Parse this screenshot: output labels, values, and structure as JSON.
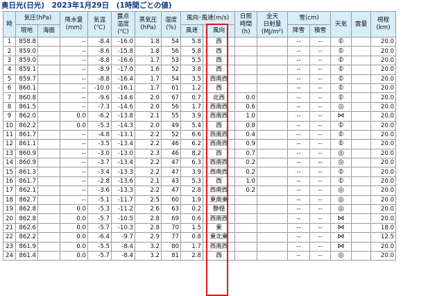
{
  "title": "奥日光(日光)　2023年1月29日　(1時間ごとの値)",
  "headers": {
    "hour": "時",
    "pressure": "気圧(hPa)",
    "pressure_station": "現地",
    "pressure_sea": "海面",
    "precip_l1": "降水量",
    "precip_l2": "(mm)",
    "temp_l1": "気温",
    "temp_l2": "(℃)",
    "dew_l1": "露点",
    "dew_l2": "温度",
    "dew_l3": "(℃)",
    "vapor_l1": "蒸気圧",
    "vapor_l2": "(hPa)",
    "humid_l1": "湿度",
    "humid_l2": "(%)",
    "wind": "風向･風速(m/s)",
    "wind_speed": "風速",
    "wind_dir": "風向",
    "sun_l1": "日照",
    "sun_l2": "時間",
    "sun_l3": "(h)",
    "rad_l1": "全天",
    "rad_l2": "日射量",
    "rad_l3": "(MJ/m²)",
    "snow": "雪(cm)",
    "snow_fall": "降雪",
    "snow_depth": "積雪",
    "weather": "天気",
    "cloud": "雲量",
    "vis_l1": "視程",
    "vis_l2": "(km)"
  },
  "rows": [
    {
      "hour": "1",
      "station": "858.8",
      "sea": "",
      "precip": "--",
      "temp": "-8.4",
      "dew": "-16.0",
      "vapor": "1.8",
      "humid": "54",
      "speed": "5.8",
      "dir": "西",
      "sun": "",
      "rad": "",
      "snowfall": "--",
      "snowdepth": "--",
      "weather": "⦶",
      "cloud": "",
      "vis": "20.0"
    },
    {
      "hour": "2",
      "station": "859.0",
      "sea": "",
      "precip": "--",
      "temp": "-8.6",
      "dew": "-15.8",
      "vapor": "1.8",
      "humid": "56",
      "speed": "5.8",
      "dir": "西",
      "sun": "",
      "rad": "",
      "snowfall": "--",
      "snowdepth": "--",
      "weather": "⦶",
      "cloud": "",
      "vis": "20.0"
    },
    {
      "hour": "3",
      "station": "859.0",
      "sea": "",
      "precip": "--",
      "temp": "-8.8",
      "dew": "-16.6",
      "vapor": "1.7",
      "humid": "53",
      "speed": "5.5",
      "dir": "西",
      "sun": "",
      "rad": "",
      "snowfall": "--",
      "snowdepth": "--",
      "weather": "⦶",
      "cloud": "",
      "vis": "20.0"
    },
    {
      "hour": "4",
      "station": "859.1",
      "sea": "",
      "precip": "--",
      "temp": "-8.9",
      "dew": "-17.0",
      "vapor": "1.6",
      "humid": "52",
      "speed": "3.8",
      "dir": "西",
      "sun": "",
      "rad": "",
      "snowfall": "--",
      "snowdepth": "--",
      "weather": "⦶",
      "cloud": "",
      "vis": "20.0"
    },
    {
      "hour": "5",
      "station": "859.7",
      "sea": "",
      "precip": "--",
      "temp": "-8.8",
      "dew": "-16.4",
      "vapor": "1.7",
      "humid": "54",
      "speed": "3.5",
      "dir": "西南西",
      "sun": "",
      "rad": "",
      "snowfall": "--",
      "snowdepth": "--",
      "weather": "⦶",
      "cloud": "",
      "vis": "20.0"
    },
    {
      "hour": "6",
      "station": "860.1",
      "sea": "",
      "precip": "--",
      "temp": "-10.0",
      "dew": "-16.1",
      "vapor": "1.7",
      "humid": "61",
      "speed": "1.2",
      "dir": "西",
      "sun": "",
      "rad": "",
      "snowfall": "--",
      "snowdepth": "--",
      "weather": "⦶",
      "cloud": "",
      "vis": "20.0"
    },
    {
      "hour": "7",
      "station": "860.8",
      "sea": "",
      "precip": "--",
      "temp": "-9.6",
      "dew": "-14.6",
      "vapor": "2.0",
      "humid": "67",
      "speed": "0.7",
      "dir": "北西",
      "sun": "0.0",
      "rad": "",
      "snowfall": "--",
      "snowdepth": "--",
      "weather": "⦶",
      "cloud": "",
      "vis": "20.0"
    },
    {
      "hour": "8",
      "station": "861.5",
      "sea": "",
      "precip": "--",
      "temp": "-7.3",
      "dew": "-14.6",
      "vapor": "2.0",
      "humid": "56",
      "speed": "1.7",
      "dir": "西南西",
      "sun": "0.6",
      "rad": "",
      "snowfall": "--",
      "snowdepth": "--",
      "weather": "◎",
      "cloud": "",
      "vis": "20.0"
    },
    {
      "hour": "9",
      "station": "862.0",
      "sea": "",
      "precip": "0.0",
      "temp": "-6.2",
      "dew": "-13.8",
      "vapor": "2.1",
      "humid": "55",
      "speed": "3.9",
      "dir": "西南西",
      "sun": "1.0",
      "rad": "",
      "snowfall": "--",
      "snowdepth": "--",
      "weather": "⋈",
      "cloud": "",
      "vis": "20.0"
    },
    {
      "hour": "10",
      "station": "862.2",
      "sea": "",
      "precip": "0.0",
      "temp": "-5.3",
      "dew": "-14.3",
      "vapor": "2.0",
      "humid": "49",
      "speed": "5.4",
      "dir": "西",
      "sun": "0.8",
      "rad": "",
      "snowfall": "--",
      "snowdepth": "--",
      "weather": "⦶",
      "cloud": "",
      "vis": "20.0"
    },
    {
      "hour": "11",
      "station": "861.7",
      "sea": "",
      "precip": "--",
      "temp": "-4.8",
      "dew": "-13.1",
      "vapor": "2.2",
      "humid": "52",
      "speed": "6.6",
      "dir": "西南西",
      "sun": "0.4",
      "rad": "",
      "snowfall": "--",
      "snowdepth": "--",
      "weather": "⦶",
      "cloud": "",
      "vis": "20.0"
    },
    {
      "hour": "12",
      "station": "861.1",
      "sea": "",
      "precip": "--",
      "temp": "-3.5",
      "dew": "-13.4",
      "vapor": "2.2",
      "humid": "46",
      "speed": "6.2",
      "dir": "西南西",
      "sun": "0.9",
      "rad": "",
      "snowfall": "--",
      "snowdepth": "--",
      "weather": "⦶",
      "cloud": "",
      "vis": "20.0"
    },
    {
      "hour": "13",
      "station": "860.9",
      "sea": "",
      "precip": "--",
      "temp": "-3.0",
      "dew": "-13.0",
      "vapor": "2.3",
      "humid": "46",
      "speed": "8.2",
      "dir": "西",
      "sun": "0.7",
      "rad": "",
      "snowfall": "--",
      "snowdepth": "--",
      "weather": "◎",
      "cloud": "",
      "vis": "20.0"
    },
    {
      "hour": "14",
      "station": "860.9",
      "sea": "",
      "precip": "--",
      "temp": "-3.7",
      "dew": "-13.4",
      "vapor": "2.2",
      "humid": "47",
      "speed": "6.3",
      "dir": "西南西",
      "sun": "0.2",
      "rad": "",
      "snowfall": "--",
      "snowdepth": "--",
      "weather": "◎",
      "cloud": "",
      "vis": "20.0"
    },
    {
      "hour": "15",
      "station": "861.3",
      "sea": "",
      "precip": "--",
      "temp": "-3.4",
      "dew": "-13.3",
      "vapor": "2.2",
      "humid": "47",
      "speed": "3.9",
      "dir": "西南西",
      "sun": "0.2",
      "rad": "",
      "snowfall": "--",
      "snowdepth": "--",
      "weather": "⦶",
      "cloud": "",
      "vis": "20.0"
    },
    {
      "hour": "16",
      "station": "861.7",
      "sea": "",
      "precip": "--",
      "temp": "-2.8",
      "dew": "-13.6",
      "vapor": "2.1",
      "humid": "43",
      "speed": "5.3",
      "dir": "西",
      "sun": "1.0",
      "rad": "",
      "snowfall": "--",
      "snowdepth": "--",
      "weather": "⦶",
      "cloud": "",
      "vis": "20.0"
    },
    {
      "hour": "17",
      "station": "862.1",
      "sea": "",
      "precip": "--",
      "temp": "-3.6",
      "dew": "-13.3",
      "vapor": "2.2",
      "humid": "47",
      "speed": "2.8",
      "dir": "西南西",
      "sun": "0.2",
      "rad": "",
      "snowfall": "--",
      "snowdepth": "--",
      "weather": "◎",
      "cloud": "",
      "vis": "20.0"
    },
    {
      "hour": "18",
      "station": "862.7",
      "sea": "",
      "precip": "--",
      "temp": "-5.1",
      "dew": "-11.7",
      "vapor": "2.5",
      "humid": "60",
      "speed": "1.9",
      "dir": "東南東",
      "sun": "",
      "rad": "",
      "snowfall": "--",
      "snowdepth": "--",
      "weather": "◎",
      "cloud": "",
      "vis": "20.0"
    },
    {
      "hour": "19",
      "station": "862.8",
      "sea": "",
      "precip": "0.0",
      "temp": "-5.3",
      "dew": "-11.2",
      "vapor": "2.6",
      "humid": "63",
      "speed": "0.2",
      "dir": "静穏",
      "sun": "",
      "rad": "",
      "snowfall": "--",
      "snowdepth": "--",
      "weather": "◎",
      "cloud": "",
      "vis": "20.0"
    },
    {
      "hour": "20",
      "station": "862.8",
      "sea": "",
      "precip": "0.0",
      "temp": "-5.7",
      "dew": "-10.5",
      "vapor": "2.8",
      "humid": "69",
      "speed": "0.6",
      "dir": "西南西",
      "sun": "",
      "rad": "",
      "snowfall": "--",
      "snowdepth": "--",
      "weather": "⋈",
      "cloud": "",
      "vis": "20.0"
    },
    {
      "hour": "21",
      "station": "862.6",
      "sea": "",
      "precip": "0.0",
      "temp": "-5.7",
      "dew": "-10.3",
      "vapor": "2.8",
      "humid": "70",
      "speed": "1.5",
      "dir": "東",
      "sun": "",
      "rad": "",
      "snowfall": "--",
      "snowdepth": "--",
      "weather": "⋈",
      "cloud": "",
      "vis": "18.0"
    },
    {
      "hour": "22",
      "station": "862.2",
      "sea": "",
      "precip": "0.0",
      "temp": "-6.4",
      "dew": "-9.7",
      "vapor": "2.9",
      "humid": "77",
      "speed": "0.8",
      "dir": "東北東",
      "sun": "",
      "rad": "",
      "snowfall": "--",
      "snowdepth": "--",
      "weather": "⋈",
      "cloud": "",
      "vis": "12.5"
    },
    {
      "hour": "23",
      "station": "861.9",
      "sea": "",
      "precip": "0.0",
      "temp": "-5.5",
      "dew": "-8.4",
      "vapor": "3.2",
      "humid": "80",
      "speed": "1.7",
      "dir": "西南西",
      "sun": "",
      "rad": "",
      "snowfall": "--",
      "snowdepth": "--",
      "weather": "⋈",
      "cloud": "",
      "vis": "20.0"
    },
    {
      "hour": "24",
      "station": "861.4",
      "sea": "",
      "precip": "0.0",
      "temp": "-5.7",
      "dew": "-8.4",
      "vapor": "3.2",
      "humid": "81",
      "speed": "2.8",
      "dir": "西",
      "sun": "",
      "rad": "",
      "snowfall": "--",
      "snowdepth": "--",
      "weather": "◎",
      "cloud": "",
      "vis": "20.0"
    }
  ]
}
